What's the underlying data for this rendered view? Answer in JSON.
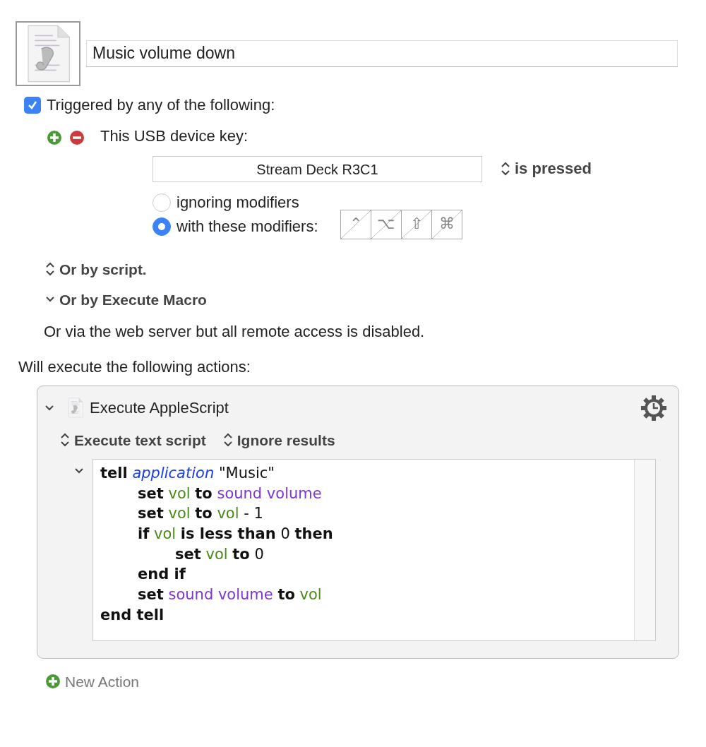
{
  "macro_name": "Music volume down",
  "trigger": {
    "label": "Triggered by any of the following:",
    "checked": true
  },
  "usb_trigger": {
    "label": "This USB device key:",
    "device_key": "Stream Deck R3C1",
    "condition": "is pressed",
    "modifier_options": [
      {
        "label": "ignoring modifiers",
        "selected": false
      },
      {
        "label": "with these modifiers:",
        "selected": true
      }
    ],
    "modifier_keys": [
      {
        "glyph": "⌃",
        "on": false
      },
      {
        "glyph": "⌥",
        "on": false
      },
      {
        "glyph": "⇧",
        "on": false
      },
      {
        "glyph": "⌘",
        "on": false
      }
    ]
  },
  "script_trigger": {
    "label": "Or by script.",
    "expanded": false
  },
  "macro_trigger": {
    "label": "Or by Execute Macro",
    "expanded": true
  },
  "web_server_note": "Or via the web server but all remote access is disabled.",
  "actions_heading": "Will execute the following actions:",
  "action": {
    "title": "Execute AppleScript",
    "expanded": true,
    "options": [
      "Execute text script",
      "Ignore results"
    ],
    "code_expanded": true,
    "code": [
      {
        "tokens": [
          {
            "kind": "keyword",
            "text": "tell"
          },
          {
            "kind": "class",
            "text": "application"
          },
          {
            "kind": "plain",
            "text": "\"Music\""
          }
        ],
        "children": [
          {
            "tokens": [
              {
                "kind": "keyword",
                "text": "set"
              },
              {
                "kind": "variable",
                "text": "vol"
              },
              {
                "kind": "keyword",
                "text": "to"
              },
              {
                "kind": "property",
                "text": "sound volume"
              }
            ]
          },
          {
            "tokens": [
              {
                "kind": "keyword",
                "text": "set"
              },
              {
                "kind": "variable",
                "text": "vol"
              },
              {
                "kind": "keyword",
                "text": "to"
              },
              {
                "kind": "variable",
                "text": "vol"
              },
              {
                "kind": "plain",
                "text": "- 1"
              }
            ]
          },
          {
            "tokens": [
              {
                "kind": "keyword",
                "text": "if"
              },
              {
                "kind": "variable",
                "text": "vol"
              },
              {
                "kind": "keyword",
                "text": "is less than"
              },
              {
                "kind": "plain",
                "text": "0"
              },
              {
                "kind": "keyword",
                "text": "then"
              }
            ],
            "children": [
              {
                "tokens": [
                  {
                    "kind": "keyword",
                    "text": "set"
                  },
                  {
                    "kind": "variable",
                    "text": "vol"
                  },
                  {
                    "kind": "keyword",
                    "text": "to"
                  },
                  {
                    "kind": "plain",
                    "text": "0"
                  }
                ]
              }
            ]
          },
          {
            "tokens": [
              {
                "kind": "keyword",
                "text": "end if"
              }
            ]
          },
          {
            "tokens": [
              {
                "kind": "keyword",
                "text": "set"
              },
              {
                "kind": "property",
                "text": "sound volume"
              },
              {
                "kind": "keyword",
                "text": "to"
              },
              {
                "kind": "variable",
                "text": "vol"
              }
            ]
          }
        ]
      },
      {
        "tokens": [
          {
            "kind": "keyword",
            "text": "end tell"
          }
        ]
      }
    ]
  },
  "new_action": "New Action"
}
